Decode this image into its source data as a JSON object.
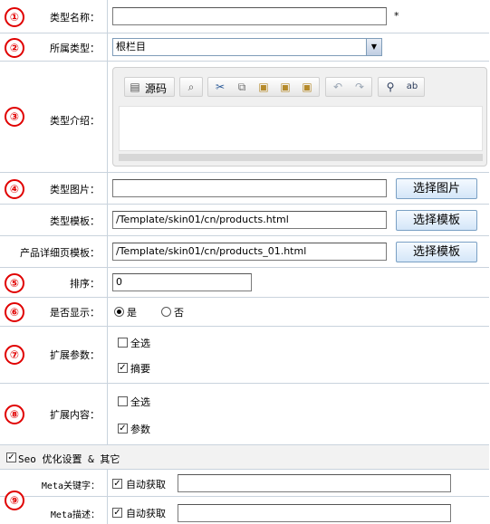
{
  "rows": {
    "name": {
      "badge": "①",
      "label": "类型名称：",
      "value": "",
      "required_mark": "*"
    },
    "parent": {
      "badge": "②",
      "label": "所属类型：",
      "selected": "根栏目"
    },
    "intro": {
      "badge": "③",
      "label": "类型介绍：",
      "toolbar": {
        "source_label": "源码"
      }
    },
    "image": {
      "badge": "④",
      "label": "类型图片：",
      "value": "",
      "button": "选择图片"
    },
    "template": {
      "label": "类型模板：",
      "value": "/Template/skin01/cn/products.html",
      "button": "选择模板"
    },
    "detail_template": {
      "label": "产品详细页模板：",
      "value": "/Template/skin01/cn/products_01.html",
      "button": "选择模板"
    },
    "sort": {
      "badge": "⑤",
      "label": "排序：",
      "value": "0"
    },
    "display": {
      "badge": "⑥",
      "label": "是否显示：",
      "yes": "是",
      "no": "否"
    },
    "ext_params": {
      "badge": "⑦",
      "label": "扩展参数：",
      "select_all": "全选",
      "item": "摘要"
    },
    "ext_content": {
      "badge": "⑧",
      "label": "扩展内容：",
      "select_all": "全选",
      "item": "参数"
    },
    "seo": {
      "label": "Seo 优化设置 & 其它"
    },
    "meta_keywords": {
      "badge": "⑨",
      "label": "Meta关键字：",
      "auto": "自动获取",
      "value": ""
    },
    "meta_desc": {
      "label": "Meta描述：",
      "auto": "自动获取",
      "value": ""
    }
  }
}
